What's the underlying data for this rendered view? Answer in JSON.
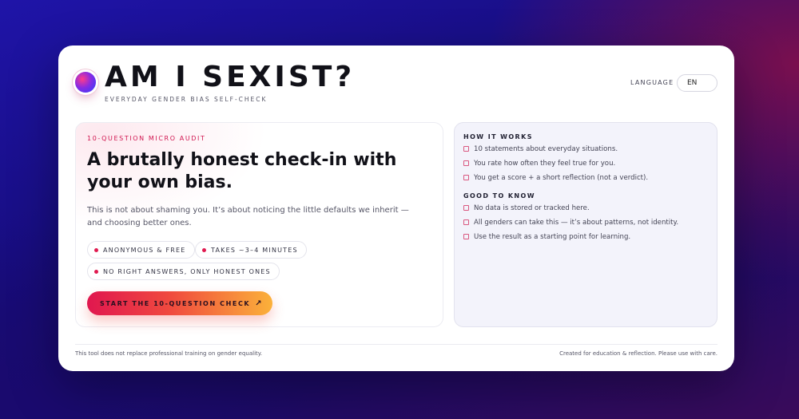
{
  "header": {
    "title": "AM I SEXIST?",
    "subtitle": "EVERYDAY GENDER BIAS SELF-CHECK",
    "language_label": "LANGUAGE",
    "language_value": "EN"
  },
  "intro": {
    "eyebrow": "10-QUESTION MICRO AUDIT",
    "headline_line1": "A brutally honest check-in with",
    "headline_line2": "your own bias.",
    "lead_line1": "This is not about shaming you. It’s about noticing the little defaults we inherit —",
    "lead_line2": "and choosing better ones.",
    "pills": [
      "ANONYMOUS & FREE",
      "TAKES ~3–4 MINUTES",
      "NO RIGHT ANSWERS, ONLY HONEST ONES"
    ],
    "cta_label": "START THE 10-QUESTION CHECK",
    "cta_arrow": "↗"
  },
  "info": {
    "how_title": "HOW IT WORKS",
    "how_items": [
      "10 statements about everyday situations.",
      "You rate how often they feel true for you.",
      "You get a score + a short reflection (not a verdict)."
    ],
    "know_title": "GOOD TO KNOW",
    "know_items": [
      "No data is stored or tracked here.",
      "All genders can take this — it’s about patterns, not identity.",
      "Use the result as a starting point for learning."
    ]
  },
  "footer": {
    "left": "This tool does not replace professional training on gender equality.",
    "right": "Created for education & reflection. Please use with care."
  },
  "colors": {
    "accent": "#e0194f",
    "cta_gradient_start": "#e0174f",
    "cta_gradient_end": "#fbb13a",
    "panel_bg": "#f3f3fb"
  }
}
